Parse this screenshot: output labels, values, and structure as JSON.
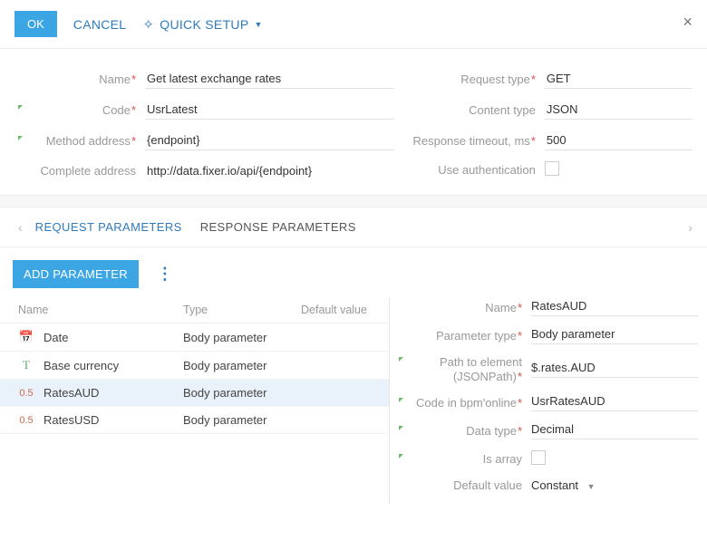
{
  "toolbar": {
    "ok": "OK",
    "cancel": "CANCEL",
    "quickSetup": "QUICK SETUP"
  },
  "form": {
    "labels": {
      "name": "Name",
      "code": "Code",
      "methodAddress": "Method address",
      "completeAddress": "Complete address",
      "requestType": "Request type",
      "contentType": "Content type",
      "responseTimeout": "Response timeout, ms",
      "useAuth": "Use authentication"
    },
    "values": {
      "name": "Get latest exchange rates",
      "code": "UsrLatest",
      "methodAddress": "{endpoint}",
      "completeAddress": "http://data.fixer.io/api/{endpoint}",
      "requestType": "GET",
      "contentType": "JSON",
      "responseTimeout": "500"
    }
  },
  "tabs": {
    "request": "REQUEST PARAMETERS",
    "response": "RESPONSE PARAMETERS"
  },
  "grid": {
    "addButton": "ADD PARAMETER",
    "headers": {
      "name": "Name",
      "type": "Type",
      "default": "Default value"
    },
    "rows": [
      {
        "icon": "date",
        "name": "Date",
        "type": "Body parameter",
        "default": ""
      },
      {
        "icon": "text",
        "name": "Base currency",
        "type": "Body parameter",
        "default": ""
      },
      {
        "icon": "dec",
        "name": "RatesAUD",
        "type": "Body parameter",
        "default": "",
        "selected": true
      },
      {
        "icon": "dec",
        "name": "RatesUSD",
        "type": "Body parameter",
        "default": ""
      }
    ]
  },
  "detail": {
    "labels": {
      "name": "Name",
      "paramType": "Parameter type",
      "pathToElement": "Path to element (JSONPath)",
      "codeInBpm": "Code in bpm'online",
      "dataType": "Data type",
      "isArray": "Is array",
      "defaultValue": "Default value"
    },
    "values": {
      "name": "RatesAUD",
      "paramType": "Body parameter",
      "pathToElement": "$.rates.AUD",
      "codeInBpm": "UsrRatesAUD",
      "dataType": "Decimal",
      "defaultValue": "Constant"
    }
  }
}
